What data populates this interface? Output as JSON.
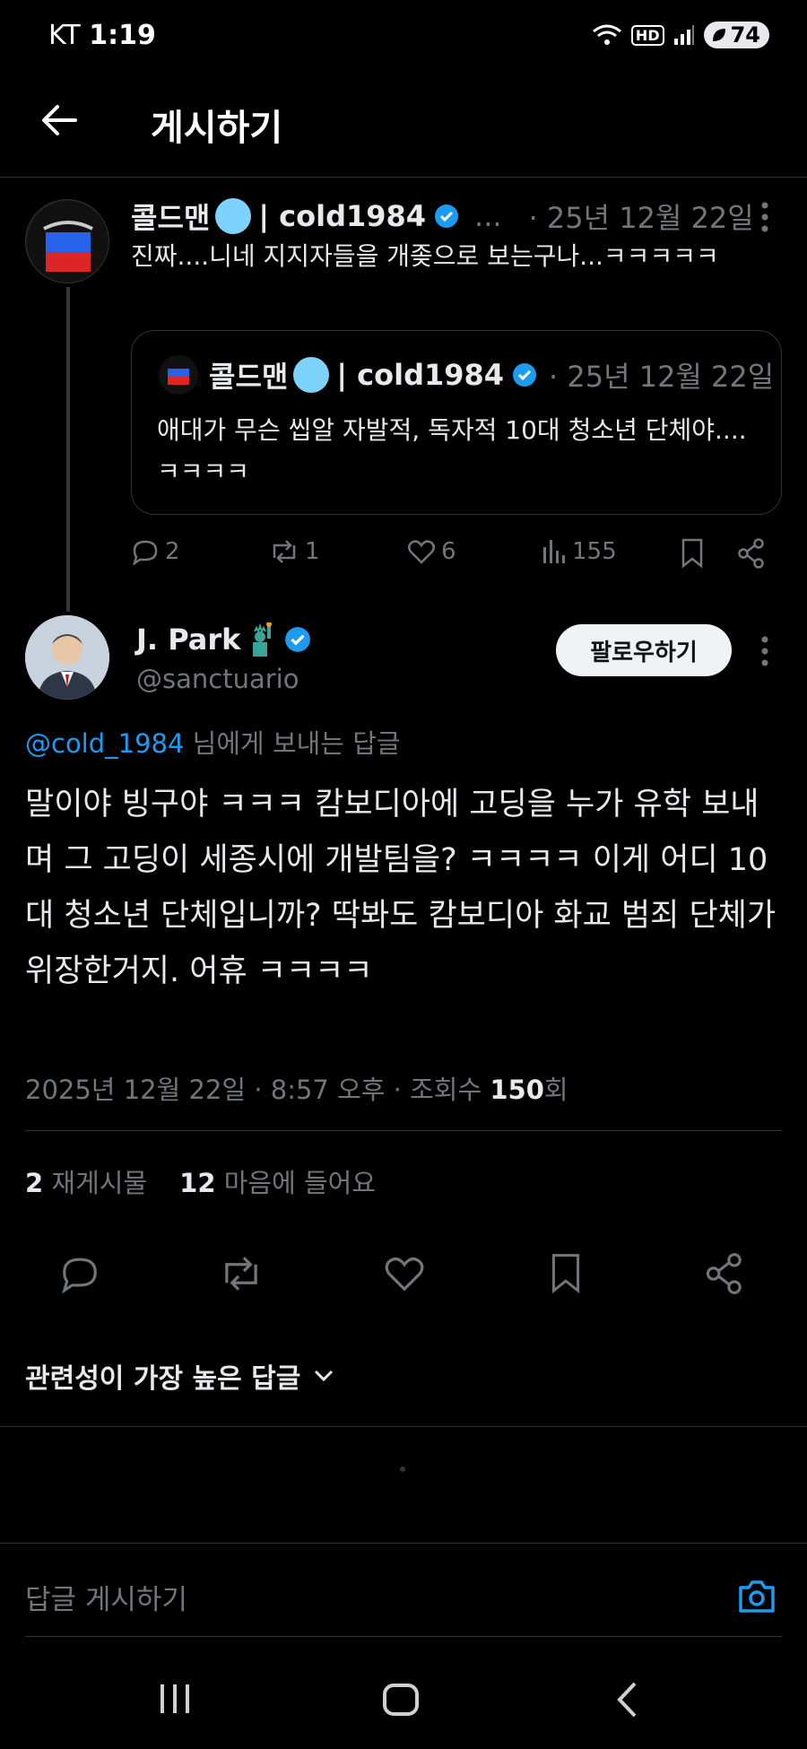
{
  "status_bar": {
    "carrier": "KT",
    "time": "1:19",
    "hd_label": "HD",
    "battery": "74"
  },
  "header": {
    "title": "게시하기"
  },
  "parent_post": {
    "display_name": "콜드맨",
    "name_suffix": "| cold1984",
    "ellipsis": "...",
    "date": "· 25년 12월 22일",
    "text": "진짜....니네 지지자들을 개좆으로 보는구나...ㅋㅋㅋㅋㅋ",
    "quote": {
      "display_name": "콜드맨",
      "name_suffix": "| cold1984",
      "date": "· 25년 12월 22일",
      "text": "애대가 무슨 씹알 자발적, 독자적 10대 청소년 단체야....ㅋㅋㅋㅋ"
    },
    "actions": {
      "replies": "2",
      "reposts": "1",
      "likes": "6",
      "views": "155"
    }
  },
  "main_post": {
    "display_name": "J. Park",
    "handle": "@sanctuario",
    "follow_label": "팔로우하기",
    "replying_to": "@cold_1984",
    "replying_suffix": " 님에게 보내는 답글",
    "text": "말이야 빙구야 ㅋㅋㅋ 캄보디아에 고딩을 누가 유학 보내며 그 고딩이 세종시에 개발팀을? ㅋㅋㅋㅋ 이게 어디 10대 청소년 단체입니까? 딱봐도 캄보디아 화교 범죄 단체가 위장한거지. 어휴 ㅋㅋㅋㅋ",
    "meta_prefix": "2025년 12월 22일 · 8:57 오후 · 조회수 ",
    "views": "150",
    "views_suffix": "회",
    "reposts_count": "2",
    "reposts_label": "재게시물",
    "likes_count": "12",
    "likes_label": "마음에 들어요"
  },
  "replies_sort": {
    "label": "관련성이 가장 높은 답글"
  },
  "composer": {
    "placeholder": "답글 게시하기"
  },
  "colors": {
    "background": "#000000",
    "accent": "#1d9bf0",
    "muted": "#71767b",
    "border": "#2f3336"
  }
}
